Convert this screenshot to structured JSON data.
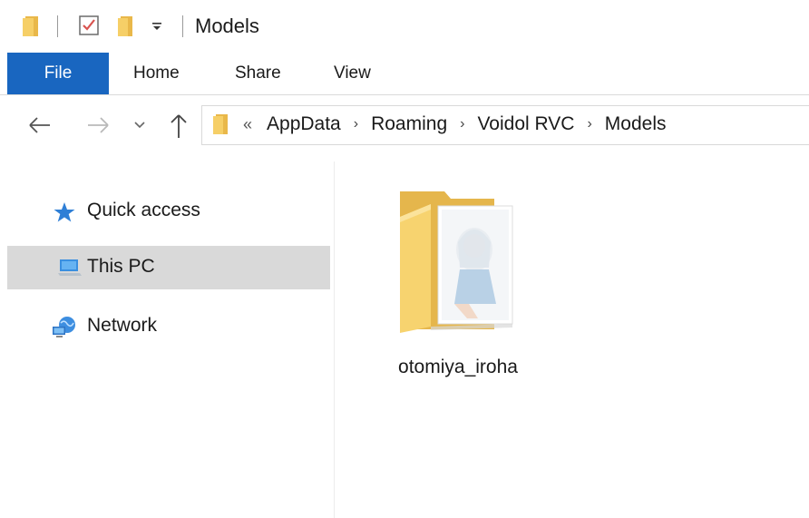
{
  "window": {
    "title": "Models"
  },
  "quick_access_toolbar": {
    "icons": [
      "folder-icon",
      "properties-checkbox-icon",
      "new-folder-icon",
      "customize-dropdown-icon"
    ]
  },
  "ribbon": {
    "tabs": [
      {
        "label": "File",
        "active": true
      },
      {
        "label": "Home"
      },
      {
        "label": "Share"
      },
      {
        "label": "View"
      }
    ]
  },
  "navigation": {
    "back_icon": "back-arrow-icon",
    "forward_icon": "forward-arrow-icon",
    "recent_icon": "chevron-down-icon",
    "up_icon": "up-arrow-icon"
  },
  "address_bar": {
    "overflow": "«",
    "crumbs": [
      "AppData",
      "Roaming",
      "Voidol RVC",
      "Models"
    ]
  },
  "sidebar": {
    "items": [
      {
        "label": "Quick access",
        "icon": "star-icon",
        "selected": false
      },
      {
        "label": "This PC",
        "icon": "computer-icon",
        "selected": true
      },
      {
        "label": "Network",
        "icon": "network-icon",
        "selected": false
      }
    ]
  },
  "content": {
    "items": [
      {
        "name": "otomiya_iroha",
        "type": "folder",
        "icon": "folder-with-image-thumbnail-icon"
      }
    ]
  },
  "colors": {
    "file_tab": "#1966c0",
    "selected_row": "#d9d9d9",
    "folder_yellow": "#f4c95d"
  }
}
